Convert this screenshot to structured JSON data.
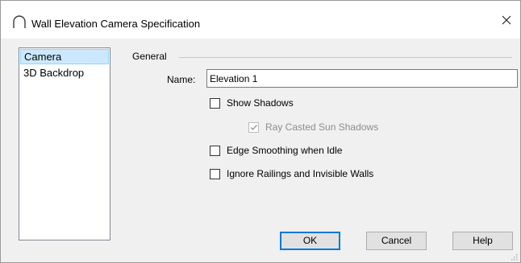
{
  "window": {
    "title": "Wall Elevation Camera Specification",
    "icon": "arch-icon",
    "close_glyph": "✕"
  },
  "sidebar": {
    "items": [
      {
        "label": "Camera",
        "selected": true
      },
      {
        "label": "3D Backdrop",
        "selected": false
      }
    ]
  },
  "general": {
    "group_label": "General",
    "name_label": "Name:",
    "name_value": "Elevation 1",
    "options": [
      {
        "label": "Show Shadows",
        "checked": false,
        "enabled": true
      },
      {
        "label": "Ray Casted Sun Shadows",
        "checked": true,
        "enabled": false
      },
      {
        "label": "Edge Smoothing when Idle",
        "checked": false,
        "enabled": true
      },
      {
        "label": "Ignore Railings and Invisible Walls",
        "checked": false,
        "enabled": true
      }
    ]
  },
  "buttons": {
    "ok_label": "OK",
    "cancel_label": "Cancel",
    "help_label": "Help"
  },
  "colors": {
    "selection_bg": "#cce8ff",
    "default_button_border": "#0078d7",
    "disabled_text": "#8d8d8d"
  }
}
